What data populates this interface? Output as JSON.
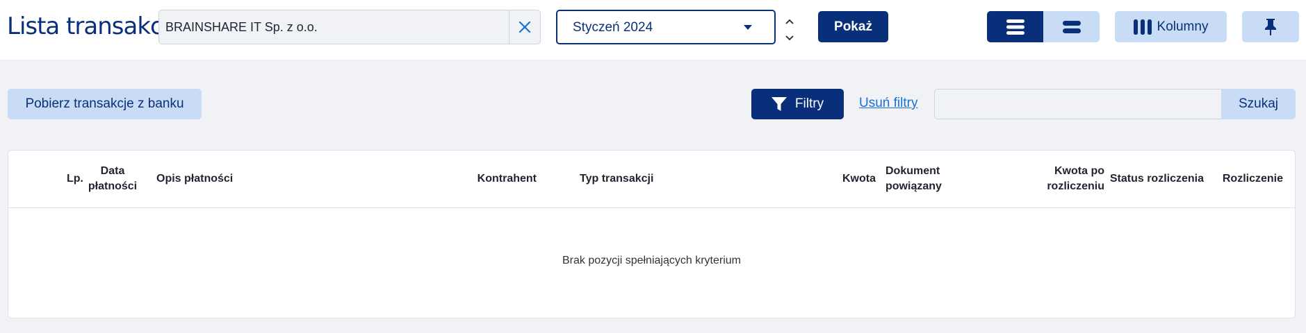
{
  "header": {
    "title": "Lista transakcji",
    "company": "BRAINSHARE IT Sp. z o.o.",
    "period": "Styczeń 2024",
    "show_label": "Pokaż",
    "columns_label": "Kolumny"
  },
  "toolbar": {
    "fetch_label": "Pobierz transakcje z banku",
    "filters_label": "Filtry",
    "remove_filters_label": "Usuń filtry",
    "search_value": "",
    "search_label": "Szukaj"
  },
  "table": {
    "columns": [
      {
        "line1": "Lp.",
        "line2": ""
      },
      {
        "line1": "Data",
        "line2": "płatności"
      },
      {
        "line1": "Opis płatności",
        "line2": ""
      },
      {
        "line1": "Kontrahent",
        "line2": ""
      },
      {
        "line1": "Typ transakcji",
        "line2": ""
      },
      {
        "line1": "Kwota",
        "line2": ""
      },
      {
        "line1": "Dokument",
        "line2": "powiązany"
      },
      {
        "line1": "Kwota po",
        "line2": "rozliczeniu"
      },
      {
        "line1": "Status rozliczenia",
        "line2": ""
      },
      {
        "line1": "Rozliczenie",
        "line2": ""
      }
    ],
    "empty_message": "Brak pozycji spełniających kryterium"
  },
  "colors": {
    "primary": "#0a2f7a",
    "secondary": "#c9dcf5",
    "link": "#1a6fd6",
    "clear_icon": "#1a6fd6",
    "background": "#f0f2f6"
  },
  "icons": [
    "close-icon",
    "caret-down-icon",
    "chevron-up-icon",
    "chevron-down-icon",
    "list-view-icon",
    "compact-view-icon",
    "columns-icon",
    "pin-icon",
    "filter-icon"
  ]
}
